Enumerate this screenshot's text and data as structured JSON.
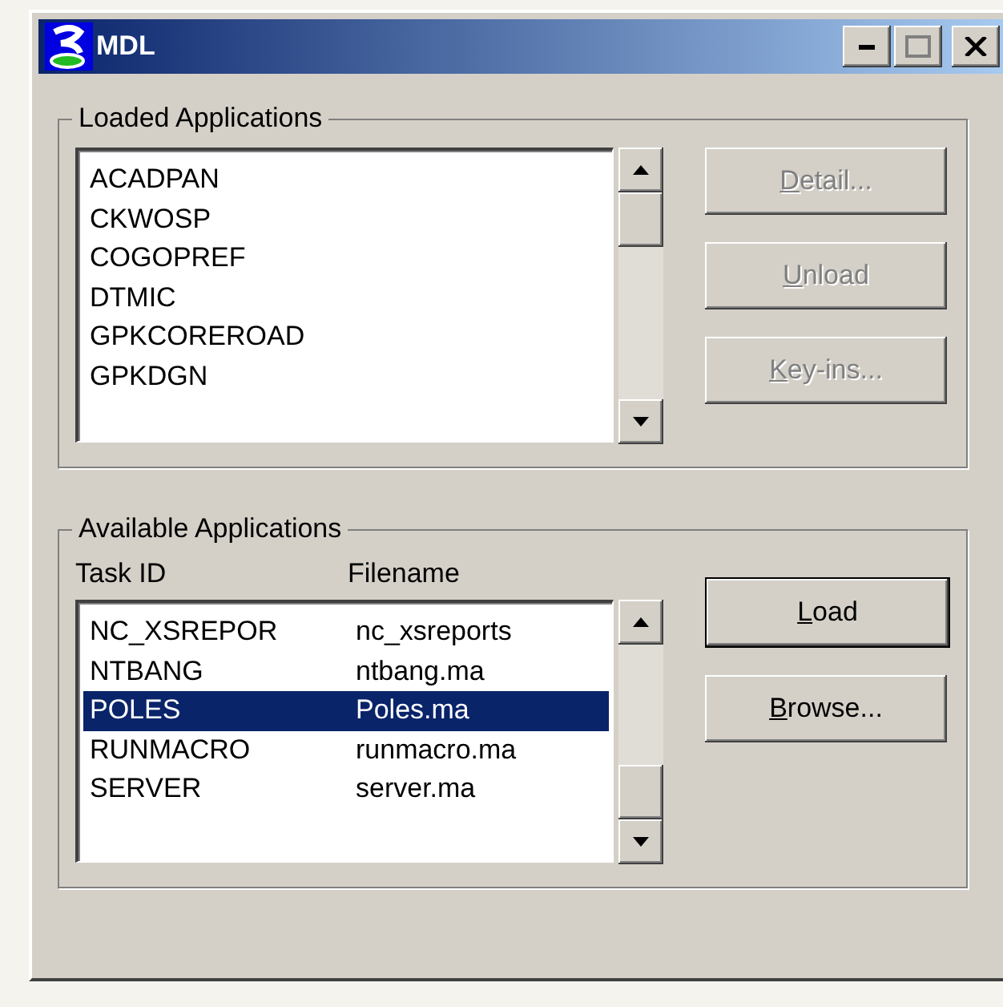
{
  "window": {
    "title": "MDL"
  },
  "loaded_applications": {
    "label": "Loaded Applications",
    "items": [
      {
        "name": "ACADPAN",
        "selected": false
      },
      {
        "name": "CKWOSP",
        "selected": false
      },
      {
        "name": "COGOPREF",
        "selected": false
      },
      {
        "name": "DTMIC",
        "selected": false
      },
      {
        "name": "GPKCOREROAD",
        "selected": false
      },
      {
        "name": "GPKDGN",
        "selected": false
      }
    ],
    "buttons": [
      {
        "label": "Detail...",
        "disabled": true,
        "default": false
      },
      {
        "label": "Unload",
        "disabled": true,
        "default": false
      },
      {
        "label": "Key-ins...",
        "disabled": true,
        "default": false
      }
    ]
  },
  "available_applications": {
    "label": "Available Applications",
    "columns": [
      "Task ID",
      "Filename"
    ],
    "rows": [
      {
        "task_id": "NC_XSREPOR",
        "filename": "nc_xsreports",
        "selected": false
      },
      {
        "task_id": "NTBANG",
        "filename": "ntbang.ma",
        "selected": false
      },
      {
        "task_id": "POLES",
        "filename": "Poles.ma",
        "selected": true
      },
      {
        "task_id": "RUNMACRO",
        "filename": "runmacro.ma",
        "selected": false
      },
      {
        "task_id": "SERVER",
        "filename": "server.ma",
        "selected": false
      }
    ],
    "buttons": [
      {
        "label": "Load",
        "disabled": false,
        "default": true
      },
      {
        "label": "Browse...",
        "disabled": false,
        "default": false
      }
    ]
  }
}
